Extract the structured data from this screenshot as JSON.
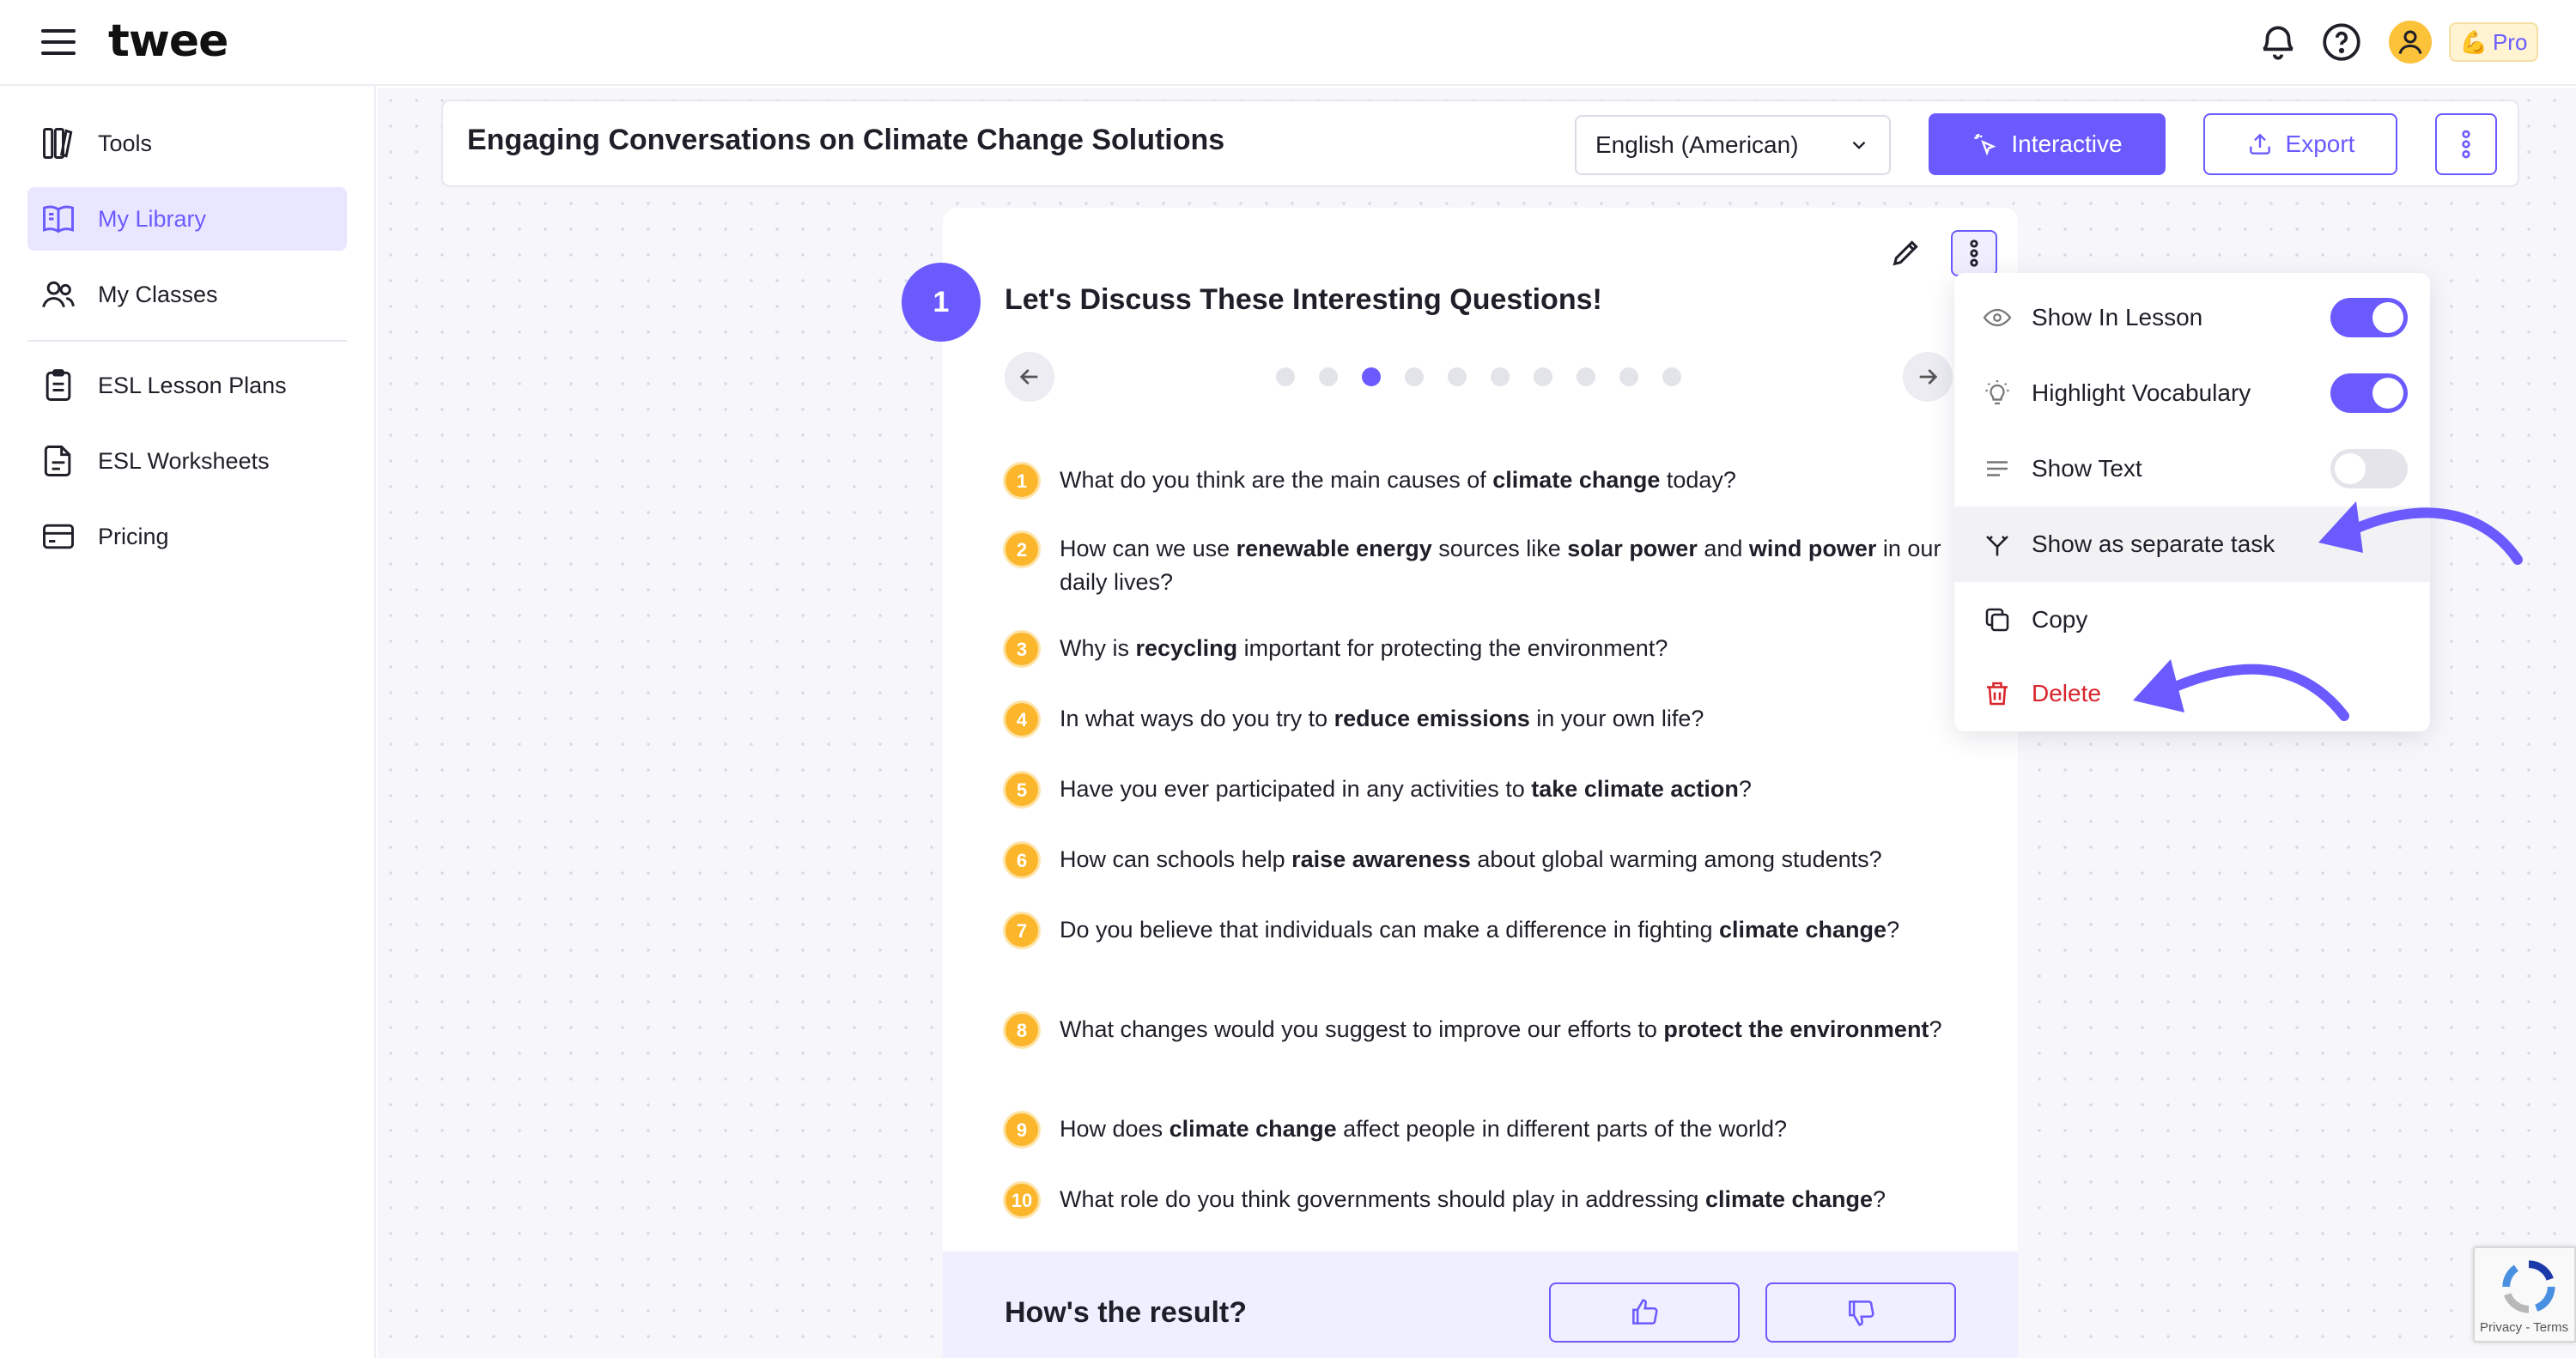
{
  "app": {
    "logo": "twee",
    "pro_label": "Pro",
    "pro_emoji": "💪"
  },
  "sidebar": {
    "items": [
      {
        "label": "Tools",
        "icon": "tools-icon"
      },
      {
        "label": "My Library",
        "icon": "book-icon",
        "active": true
      },
      {
        "label": "My Classes",
        "icon": "users-icon"
      },
      {
        "label": "ESL Lesson Plans",
        "icon": "clipboard-icon"
      },
      {
        "label": "ESL Worksheets",
        "icon": "worksheet-icon"
      },
      {
        "label": "Pricing",
        "icon": "card-icon"
      }
    ]
  },
  "header": {
    "title": "Engaging Conversations on Climate Change Solutions",
    "language": "English (American)",
    "interactive_label": "Interactive",
    "export_label": "Export"
  },
  "task": {
    "number": "1",
    "title": "Let's Discuss These Interesting Questions!",
    "pages_total": 10,
    "current_page": 3,
    "questions": [
      {
        "n": "1",
        "parts": [
          [
            "What do you think are the main causes of ",
            false
          ],
          [
            "climate change",
            true
          ],
          [
            " today?",
            false
          ]
        ]
      },
      {
        "n": "2",
        "parts": [
          [
            "How can we use ",
            false
          ],
          [
            "renewable energy",
            true
          ],
          [
            " sources like ",
            false
          ],
          [
            "solar power",
            true
          ],
          [
            " and ",
            false
          ],
          [
            "wind power",
            true
          ],
          [
            " in our daily lives?",
            false
          ]
        ]
      },
      {
        "n": "3",
        "parts": [
          [
            "Why is ",
            false
          ],
          [
            "recycling",
            true
          ],
          [
            " important for protecting the environment?",
            false
          ]
        ]
      },
      {
        "n": "4",
        "parts": [
          [
            "In what ways do you try to ",
            false
          ],
          [
            "reduce emissions",
            true
          ],
          [
            " in your own life?",
            false
          ]
        ]
      },
      {
        "n": "5",
        "parts": [
          [
            "Have you ever participated in any activities to ",
            false
          ],
          [
            "take climate action",
            true
          ],
          [
            "?",
            false
          ]
        ]
      },
      {
        "n": "6",
        "parts": [
          [
            "How can schools help ",
            false
          ],
          [
            "raise awareness",
            true
          ],
          [
            " about global warming among students?",
            false
          ]
        ]
      },
      {
        "n": "7",
        "parts": [
          [
            "Do you believe that individuals can make a difference in fighting ",
            false
          ],
          [
            "climate change",
            true
          ],
          [
            "?",
            false
          ]
        ]
      },
      {
        "n": "8",
        "parts": [
          [
            "What changes would you suggest to improve our efforts to ",
            false
          ],
          [
            "protect the environment",
            true
          ],
          [
            "?",
            false
          ]
        ]
      },
      {
        "n": "9",
        "parts": [
          [
            "How does ",
            false
          ],
          [
            "climate change",
            true
          ],
          [
            " affect people in different parts of the world?",
            false
          ]
        ]
      },
      {
        "n": "10",
        "parts": [
          [
            "What role do you think governments should play in addressing ",
            false
          ],
          [
            "climate change",
            true
          ],
          [
            "?",
            false
          ]
        ]
      }
    ]
  },
  "feedback": {
    "label": "How's the result?"
  },
  "menu": {
    "items": [
      {
        "label": "Show In Lesson",
        "icon": "eye-icon",
        "toggle": "on"
      },
      {
        "label": "Highlight Vocabulary",
        "icon": "bulb-icon",
        "toggle": "on"
      },
      {
        "label": "Show Text",
        "icon": "text-lines-icon",
        "toggle": "off"
      },
      {
        "label": "Show as separate task",
        "icon": "split-icon"
      },
      {
        "label": "Copy",
        "icon": "copy-icon"
      },
      {
        "label": "Delete",
        "icon": "trash-icon"
      }
    ]
  },
  "recaptcha": {
    "text": "Privacy - Terms"
  },
  "colors": {
    "accent": "#6b5bff",
    "badge": "#fbb62b",
    "danger": "#d9242b",
    "annotation": "#6b5bff"
  }
}
